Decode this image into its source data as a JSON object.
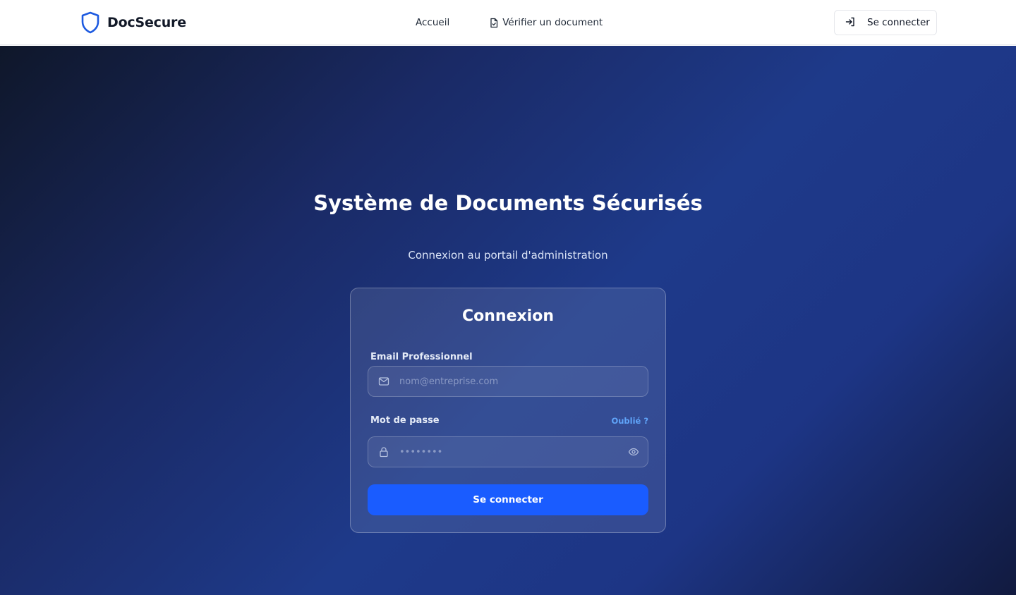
{
  "brand": {
    "name": "DocSecure",
    "icon": "shield-icon",
    "accent": "#1a5cff"
  },
  "nav": {
    "links": [
      {
        "label": "Accueil"
      },
      {
        "label": "Vérifier un document",
        "icon": "file-check-icon"
      }
    ],
    "login_label": "Se connecter",
    "login_icon": "log-in-icon"
  },
  "hero": {
    "title": "Système de Documents Sécurisés",
    "subtitle": "Connexion au portail d'administration"
  },
  "login_card": {
    "title": "Connexion",
    "email": {
      "label": "Email Professionnel",
      "placeholder": "nom@entreprise.com",
      "value": "",
      "icon": "mail-icon"
    },
    "password": {
      "label": "Mot de passe",
      "forgot_label": "Oublié ?",
      "placeholder": "••••••••",
      "value": "",
      "icon": "lock-icon",
      "toggle_icon": "eye-icon"
    },
    "submit_label": "Se connecter"
  },
  "colors": {
    "submit_button": "#1a5cff",
    "link": "#60a5fa",
    "hero_dark": "#0f172a",
    "hero_blue": "#1e3a8a"
  }
}
